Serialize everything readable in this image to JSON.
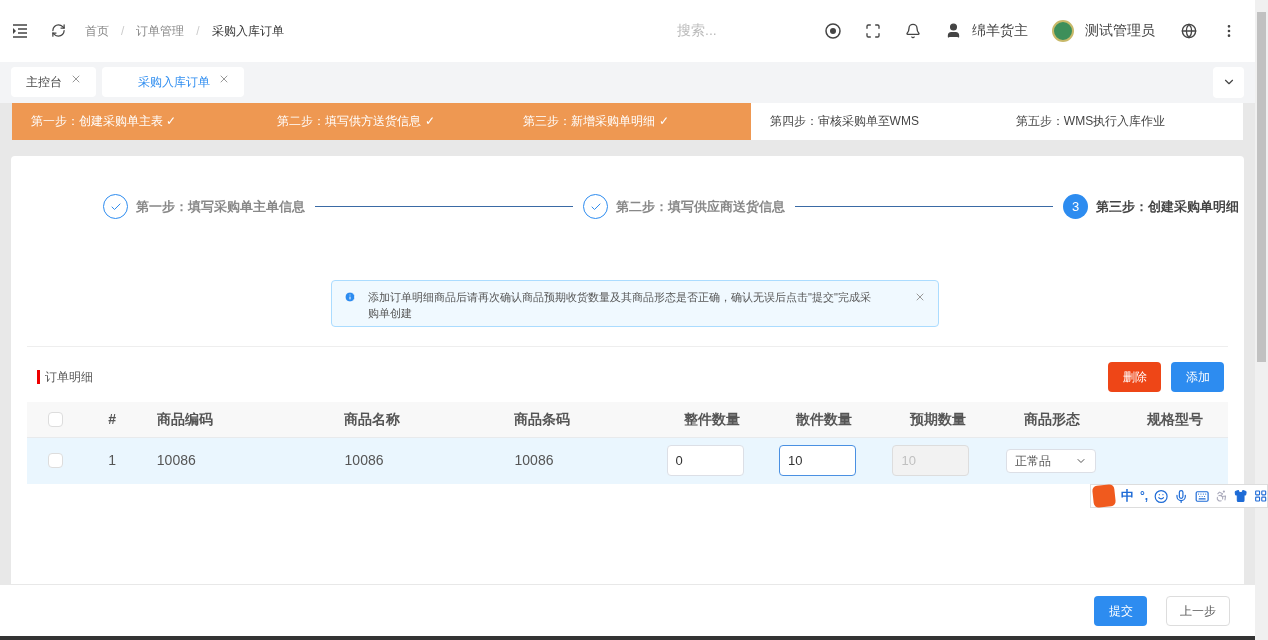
{
  "breadcrumb": [
    "首页",
    "订单管理",
    "采购入库订单"
  ],
  "breadcrumb_separator": "/",
  "search": {
    "placeholder": "搜索..."
  },
  "header": {
    "owner": "绵羊货主",
    "user": "测试管理员"
  },
  "tabs": [
    {
      "label": "主控台",
      "selected": false
    },
    {
      "label": "采购入库订单",
      "selected": true
    }
  ],
  "progress": [
    {
      "label": "第一步：创建采购单主表 ✓",
      "done": true
    },
    {
      "label": "第二步：填写供方送货信息 ✓",
      "done": true
    },
    {
      "label": "第三步：新增采购单明细 ✓",
      "done": true
    },
    {
      "label": "第四步：审核采购单至WMS",
      "done": false
    },
    {
      "label": "第五步：WMS执行入库作业",
      "done": false
    }
  ],
  "steps": [
    {
      "kind": "done",
      "title": "第一步：填写采购单主单信息"
    },
    {
      "kind": "done",
      "title": "第二步：填写供应商送货信息"
    },
    {
      "kind": "active",
      "number": "3",
      "title": "第三步：创建采购单明细"
    }
  ],
  "alert": {
    "text": "添加订单明细商品后请再次确认商品预期收货数量及其商品形态是否正确，确认无误后点击\"提交\"完成采购单创建"
  },
  "section_title": "订单明细",
  "actions": [
    {
      "label": "删除",
      "kind": "danger"
    },
    {
      "label": "添加",
      "kind": "primary"
    }
  ],
  "table": {
    "select_all_checked": false,
    "columns": [
      "#",
      "商品编码",
      "商品名称",
      "商品条码",
      "整件数量",
      "散件数量",
      "预期数量",
      "商品形态",
      "规格型号"
    ],
    "rows": [
      {
        "checked": false,
        "highlighted": true,
        "cells": [
          {
            "kind": "text",
            "value": "1"
          },
          {
            "kind": "text",
            "value": "10086"
          },
          {
            "kind": "text",
            "value": "10086"
          },
          {
            "kind": "text",
            "value": "10086"
          },
          {
            "kind": "input",
            "value": "0",
            "focused": false,
            "disabled": false
          },
          {
            "kind": "input",
            "value": "10",
            "focused": true,
            "disabled": false
          },
          {
            "kind": "input",
            "value": "10",
            "focused": false,
            "disabled": true
          },
          {
            "kind": "select",
            "value": "正常品"
          },
          {
            "kind": "empty"
          }
        ]
      }
    ]
  },
  "ime_toolbar": {
    "mode": "中",
    "punct": "°,"
  },
  "footer": [
    {
      "label": "提交",
      "kind": "primary"
    },
    {
      "label": "上一步",
      "kind": "default"
    }
  ]
}
